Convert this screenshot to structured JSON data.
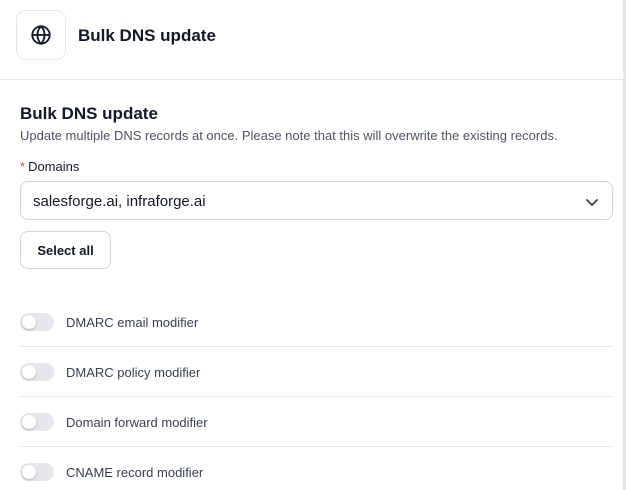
{
  "header": {
    "icon": "globe-icon",
    "title": "Bulk DNS update"
  },
  "section": {
    "title": "Bulk DNS update",
    "description": "Update multiple DNS records at once. Please note that this will overwrite the existing records."
  },
  "domains_field": {
    "required_mark": "*",
    "label": "Domains",
    "value": "salesforge.ai, infraforge.ai"
  },
  "select_all_label": "Select all",
  "modifiers": [
    {
      "label": "DMARC email modifier",
      "enabled": false
    },
    {
      "label": "DMARC policy modifier",
      "enabled": false
    },
    {
      "label": "Domain forward modifier",
      "enabled": false
    },
    {
      "label": "CNAME record modifier",
      "enabled": false
    }
  ],
  "colors": {
    "required": "#ef4444",
    "toggle_off": "#e5e7eb",
    "border": "#d1d5db"
  }
}
